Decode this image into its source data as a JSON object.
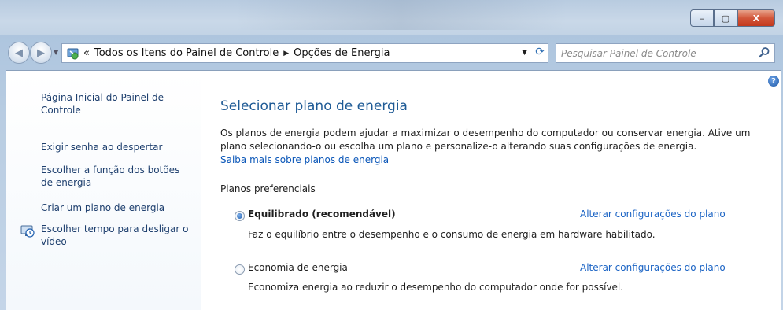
{
  "window": {
    "minimize_label": "–",
    "maximize_label": "▢",
    "close_label": "X"
  },
  "address": {
    "overflow": "«",
    "crumbs": [
      "Todos os Itens do Painel de Controle",
      "Opções de Energia"
    ],
    "search_placeholder": "Pesquisar Painel de Controle"
  },
  "sidebar": {
    "items": [
      {
        "label": "Página Inicial do Painel de Controle"
      },
      {
        "label": "Exigir senha ao despertar"
      },
      {
        "label": "Escolher a função dos botões de energia"
      },
      {
        "label": "Criar um plano de energia"
      },
      {
        "label": "Escolher tempo para desligar o vídeo"
      }
    ]
  },
  "main": {
    "title": "Selecionar plano de energia",
    "description": "Os planos de energia podem ajudar a maximizar o desempenho do computador ou conservar energia. Ative um plano selecionando-o ou escolha um plano e personalize-o alterando suas configurações de energia.",
    "learn_more": "Saiba mais sobre planos de energia",
    "group_label": "Planos preferenciais",
    "plans": [
      {
        "name": "Equilibrado (recomendável)",
        "selected": true,
        "link": "Alterar configurações do plano",
        "description": "Faz o equilíbrio entre o desempenho e o consumo de energia em hardware habilitado."
      },
      {
        "name": "Economia de energia",
        "selected": false,
        "link": "Alterar configurações do plano",
        "description": "Economiza energia ao reduzir o desempenho do computador onde for possível."
      }
    ]
  },
  "colors": {
    "link": "#1a63c4",
    "title": "#1e5a95",
    "sidebar_text": "#1e3f6e"
  },
  "icons": [
    "back-icon",
    "forward-icon",
    "control-panel-icon",
    "refresh-icon",
    "search-icon",
    "monitor-clock-icon",
    "help-icon"
  ]
}
